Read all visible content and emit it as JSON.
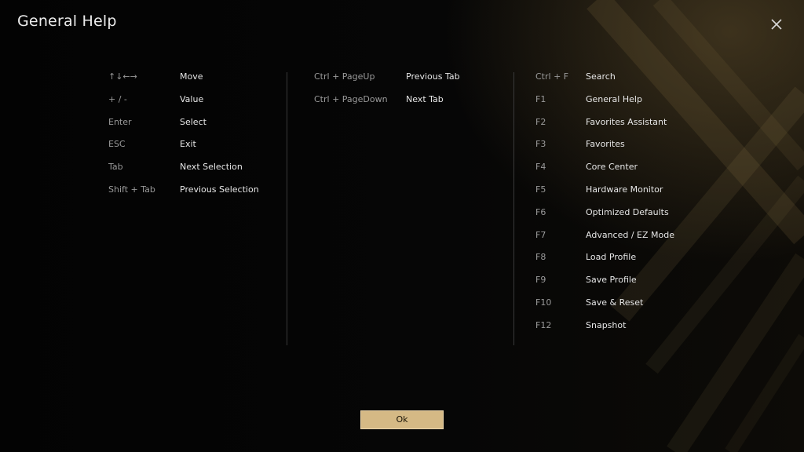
{
  "dialog": {
    "title": "General Help",
    "close_icon": "close-icon",
    "ok_label": "Ok",
    "accent_color": "#d5b985"
  },
  "columns": [
    {
      "rows": [
        {
          "key": "↑↓←→",
          "action": "Move"
        },
        {
          "key": "+ / -",
          "action": "Value"
        },
        {
          "key": "Enter",
          "action": "Select"
        },
        {
          "key": "ESC",
          "action": "Exit"
        },
        {
          "key": "Tab",
          "action": "Next Selection"
        },
        {
          "key": "Shift + Tab",
          "action": "Previous Selection"
        }
      ]
    },
    {
      "rows": [
        {
          "key": "Ctrl + PageUp",
          "action": "Previous Tab"
        },
        {
          "key": "Ctrl + PageDown",
          "action": "Next Tab"
        }
      ]
    },
    {
      "rows": [
        {
          "key": "Ctrl + F",
          "action": "Search"
        },
        {
          "key": "F1",
          "action": "General Help"
        },
        {
          "key": "F2",
          "action": "Favorites Assistant"
        },
        {
          "key": "F3",
          "action": "Favorites"
        },
        {
          "key": "F4",
          "action": "Core Center"
        },
        {
          "key": "F5",
          "action": "Hardware Monitor"
        },
        {
          "key": "F6",
          "action": "Optimized Defaults"
        },
        {
          "key": "F7",
          "action": "Advanced / EZ Mode"
        },
        {
          "key": "F8",
          "action": "Load Profile"
        },
        {
          "key": "F9",
          "action": "Save Profile"
        },
        {
          "key": "F10",
          "action": "Save & Reset"
        },
        {
          "key": "F12",
          "action": "Snapshot"
        }
      ]
    }
  ]
}
